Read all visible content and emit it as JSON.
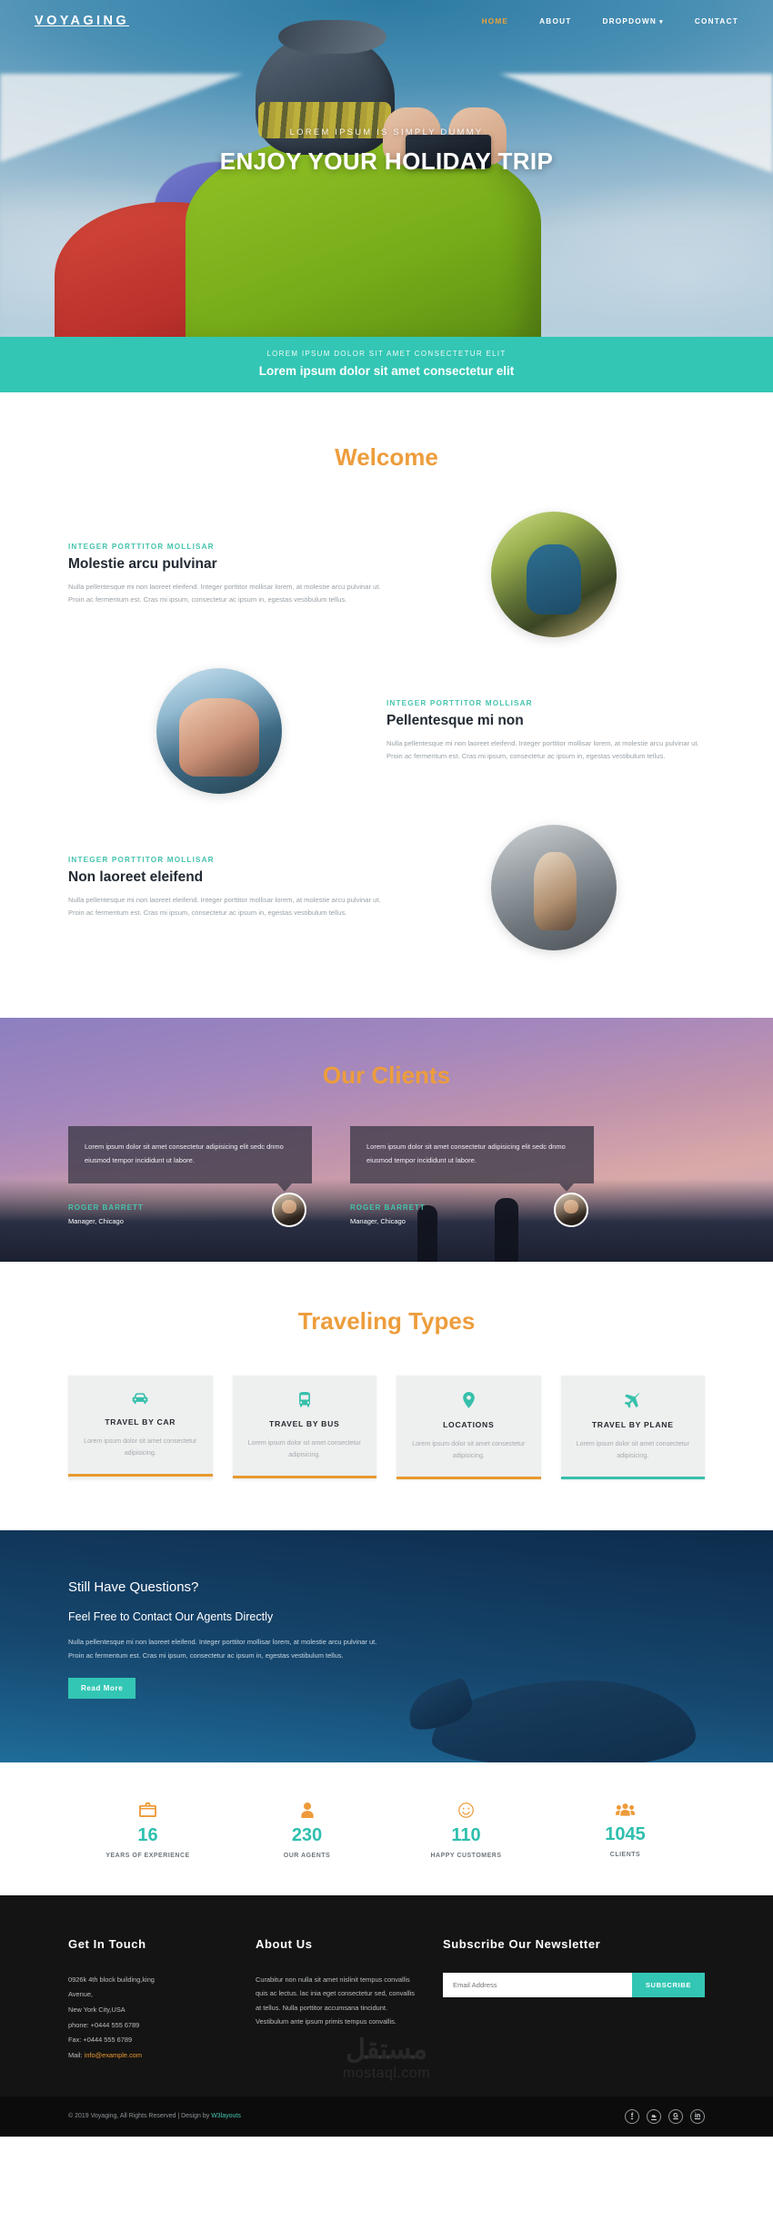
{
  "nav": {
    "brand": "VOYAGING",
    "links": [
      {
        "label": "HOME",
        "active": true
      },
      {
        "label": "ABOUT",
        "active": false
      },
      {
        "label": "DROPDOWN",
        "active": false,
        "caret": "▾"
      },
      {
        "label": "CONTACT",
        "active": false
      }
    ]
  },
  "hero": {
    "subtitle": "LOREM IPSUM IS SIMPLY DUMMY",
    "title": "ENJOY YOUR HOLIDAY TRIP"
  },
  "banner": {
    "small": "LOREM IPSUM DOLOR SIT AMET CONSECTETUR ELIT",
    "big": "Lorem ipsum dolor sit amet consectetur elit"
  },
  "welcome": {
    "title": "Welcome",
    "blocks": [
      {
        "kicker": "INTEGER PORTTITOR MOLLISAR",
        "heading": "Molestie arcu pulvinar",
        "body": "Nulla pellentesque mi non laoreet eleifend. Integer porttitor mollisar lorem, at molestie arcu pulvinar ut. Proin ac fermentum est. Cras mi ipsum, consectetur ac ipsum in, egestas vestibulum tellus."
      },
      {
        "kicker": "INTEGER PORTTITOR MOLLISAR",
        "heading": "Pellentesque mi non",
        "body": "Nulla pellentesque mi non laoreet eleifend. Integer porttitor mollisar lorem, at molestie arcu pulvinar ut. Proin ac fermentum est. Cras mi ipsum, consectetur ac ipsum in, egestas vestibulum tellus."
      },
      {
        "kicker": "INTEGER PORTTITOR MOLLISAR",
        "heading": "Non laoreet eleifend",
        "body": "Nulla pellentesque mi non laoreet eleifend. Integer porttitor mollisar lorem, at molestie arcu pulvinar ut. Proin ac fermentum est. Cras mi ipsum, consectetur ac ipsum in, egestas vestibulum tellus."
      }
    ]
  },
  "clients": {
    "title": "Our Clients",
    "items": [
      {
        "quote": "Lorem ipsum dolor sit amet consectetur adipisicing elit sedc dnmo eiusmod tempor incididunt ut labore.",
        "name": "ROGER BARRETT",
        "role": "Manager, Chicago"
      },
      {
        "quote": "Lorem ipsum dolor sit amet consectetur adipisicing elit sedc dnmo eiusmod tempor incididunt ut labore.",
        "name": "ROGER BARRETT",
        "role": "Manager, Chicago"
      }
    ]
  },
  "types": {
    "title": "Traveling Types",
    "cards": [
      {
        "icon": "car-icon",
        "title": "TRAVEL BY CAR",
        "body": "Lorem ipsum dolor sit amet consectetur adipisicing.",
        "bar_color": "#e8992f"
      },
      {
        "icon": "bus-icon",
        "title": "TRAVEL BY BUS",
        "body": "Lorem ipsum dolor sit amet consectetur adipisicing.",
        "bar_color": "#e8992f"
      },
      {
        "icon": "location-pin-icon",
        "title": "LOCATIONS",
        "body": "Lorem ipsum dolor sit amet consectetur adipisicing.",
        "bar_color": "#e8992f"
      },
      {
        "icon": "plane-icon",
        "title": "TRAVEL BY PLANE",
        "body": "Lorem ipsum dolor sit amet consectetur adipisicing.",
        "bar_color": "#36c0ab"
      }
    ]
  },
  "questions": {
    "heading": "Still Have Questions?",
    "subheading": "Feel Free to Contact Our Agents Directly",
    "body": "Nulla pellentesque mi non laoreet eleifend. Integer porttitor mollisar lorem, at molestie arcu pulvinar ut. Proin ac fermentum est. Cras mi ipsum, consectetur ac ipsum in, egestas vestibulum tellus.",
    "button": "Read More"
  },
  "stats": [
    {
      "icon": "briefcase-icon",
      "value": "16",
      "label": "YEARS OF EXPERIENCE"
    },
    {
      "icon": "user-icon",
      "value": "230",
      "label": "OUR AGENTS"
    },
    {
      "icon": "smiley-icon",
      "value": "110",
      "label": "HAPPY CUSTOMERS"
    },
    {
      "icon": "group-icon",
      "value": "1045",
      "label": "CLIENTS"
    }
  ],
  "footer": {
    "contact": {
      "heading": "Get In Touch",
      "address1": "0926k 4th block building,king",
      "address2": "Avenue,",
      "address3": "New York City,USA",
      "phone": "phone: +0444 555 6789",
      "fax": "Fax: +0444 555 6789",
      "mail_label": "Mail:",
      "mail": "info@example.com"
    },
    "about": {
      "heading": "About Us",
      "body": "Curabitur non nulla sit amet nislinit tempus convallis quis ac lectus. lac inia eget consectetur sed, convallis at tellus. Nulla porttitor accumsana tincidunt. Vestibulum ante ipsum primis tempus convallis."
    },
    "newsletter": {
      "heading": "Subscribe Our Newsletter",
      "placeholder": "Email Address",
      "value": "",
      "button": "SUBSCRIBE"
    },
    "watermark_ar": "مستقل",
    "watermark_en": "mostaql.com"
  },
  "copyright": {
    "text": "© 2019 Voyaging, All Rights Reserved | Design by ",
    "designer": "W3layouts",
    "socials": [
      {
        "name": "facebook-icon",
        "glyph": "f"
      },
      {
        "name": "twitter-icon",
        "glyph": "❧"
      },
      {
        "name": "google-plus-icon",
        "glyph": "G"
      },
      {
        "name": "linkedin-icon",
        "glyph": "in"
      }
    ]
  },
  "colors": {
    "accent_orange": "#ed9d3c",
    "accent_teal": "#33c6b4",
    "nav_active": "#e8a33d",
    "kicker_teal": "#45c4ad",
    "stat_number": "#2fbfae"
  }
}
